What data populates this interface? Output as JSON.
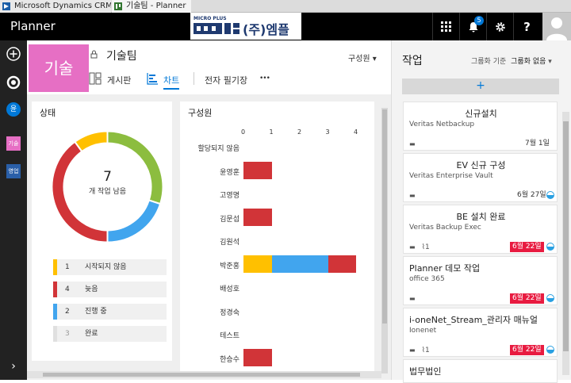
{
  "browser": {
    "tabs": [
      {
        "label": "Microsoft Dynamics CRM Onl..."
      },
      {
        "label": "기술팀 - Planner"
      }
    ]
  },
  "header": {
    "app_name": "Planner",
    "logo_text_small": "MICRO PLUS",
    "logo_text": "(주)엠플",
    "notification_count": "5",
    "help_label": "?"
  },
  "leftnav": {
    "items": [
      {
        "label": "+"
      },
      {
        "label": ""
      },
      {
        "label": "윤"
      },
      {
        "label": "기술"
      },
      {
        "label": "영업"
      },
      {
        "label": "›"
      }
    ]
  },
  "plan": {
    "tile_label": "기술",
    "title": "기술팀",
    "members_label": "구성원",
    "tabs": [
      {
        "label": "게시판"
      },
      {
        "label": "차트"
      },
      {
        "label": "전자 필기장"
      },
      {
        "label": "•••"
      }
    ]
  },
  "status_panel": {
    "title": "상태",
    "remaining_count": "7",
    "remaining_label": "개 작업 남음",
    "legend": [
      {
        "count": "1",
        "label": "시작되지 않음",
        "color": "#ffc000"
      },
      {
        "count": "4",
        "label": "늦음",
        "color": "#d13438"
      },
      {
        "count": "2",
        "label": "진행 중",
        "color": "#41a5ee"
      },
      {
        "count": "3",
        "label": "완료",
        "color": "#8cbd3f"
      }
    ]
  },
  "members_panel": {
    "title": "구성원"
  },
  "chart_data": [
    {
      "type": "pie",
      "categories": [
        "시작되지 않음",
        "늦음",
        "진행 중",
        "완료"
      ],
      "values": [
        1,
        4,
        2,
        3
      ],
      "colors": [
        "#ffc000",
        "#d13438",
        "#41a5ee",
        "#8cbd3f"
      ]
    },
    {
      "type": "bar",
      "orientation": "horizontal",
      "stacked": true,
      "categories": [
        "할당되지 않음",
        "윤영훈",
        "고영명",
        "김문섭",
        "김원석",
        "박준홍",
        "배성호",
        "정경숙",
        "테스트",
        "한승수"
      ],
      "xlim": [
        0,
        4
      ],
      "xticks": [
        "0",
        "1",
        "2",
        "3",
        "4"
      ],
      "series": [
        {
          "color": "#ffc000",
          "values": [
            0,
            0,
            0,
            0,
            0,
            1,
            0,
            0,
            0,
            0
          ]
        },
        {
          "color": "#41a5ee",
          "values": [
            0,
            0,
            0,
            0,
            0,
            2,
            0,
            0,
            0,
            0
          ]
        },
        {
          "color": "#d13438",
          "values": [
            0,
            1,
            0,
            1,
            0,
            1,
            0,
            0,
            0,
            1
          ]
        }
      ]
    }
  ],
  "tasks": {
    "title": "작업",
    "group_by_label": "그룹화 기준",
    "group_by_value": "그룹화 없음",
    "add_label": "+",
    "cards": [
      {
        "title": "신규설치",
        "sub": "Veritas Netbackup",
        "attach": "",
        "date": "7월 1일",
        "late": false,
        "progress": false
      },
      {
        "title": "EV 신규 구성",
        "sub": "Veritas Enterprise Vault",
        "attach": "",
        "date": "6월 27일",
        "late": false,
        "progress": true
      },
      {
        "title": "BE 설치 완료",
        "sub": "Veritas Backup Exec",
        "attach": "1",
        "date": "6월 22일",
        "late": true,
        "progress": true
      },
      {
        "title": "Planner 데모 작업",
        "sub": "office 365",
        "attach": "",
        "date": "6월 22일",
        "late": true,
        "progress": true
      },
      {
        "title": "i-oneNet_Stream_관리자 매뉴얼",
        "sub": "Ionenet",
        "attach": "1",
        "date": "6월 22일",
        "late": true,
        "progress": true
      },
      {
        "title": "법무법인",
        "sub": "",
        "attach": "",
        "date": "",
        "late": false,
        "progress": false
      }
    ]
  }
}
